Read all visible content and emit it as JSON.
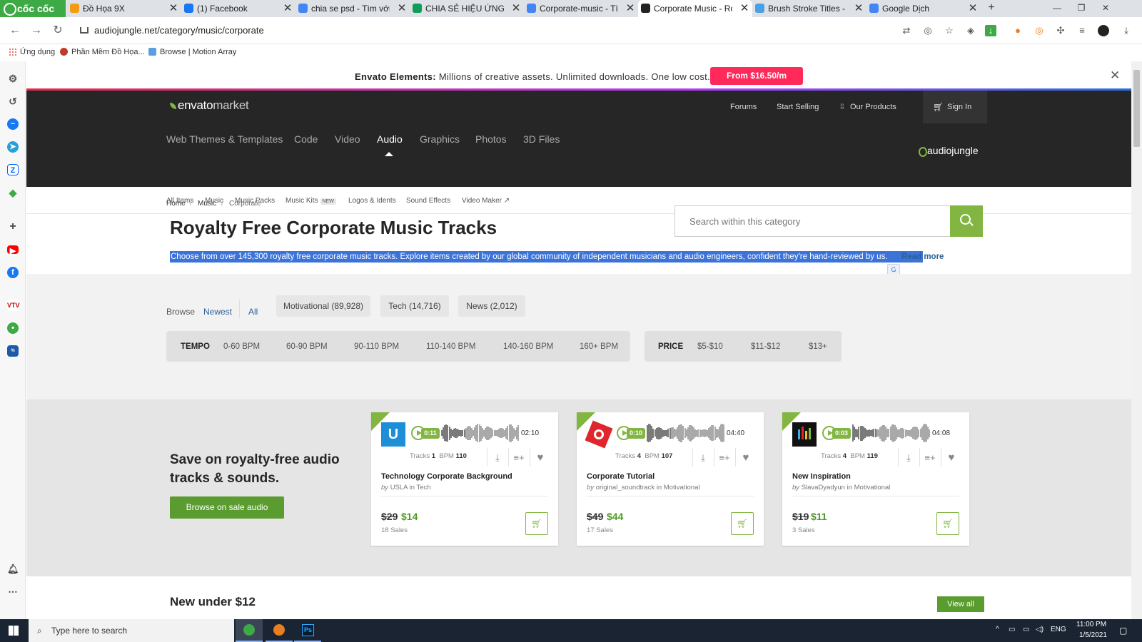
{
  "browser": {
    "brand": "cốc cốc",
    "tabs": [
      {
        "title": "Đồ Họa 9X",
        "color": "#f39c12"
      },
      {
        "title": "(1) Facebook",
        "color": "#1877f2"
      },
      {
        "title": "chia se psd - Tìm với G",
        "color": "#4285f4"
      },
      {
        "title": "CHIA SẺ HIỆU ỨNG CH",
        "color": "#0f9d58"
      },
      {
        "title": "Corporate-music - Tìm",
        "color": "#4285f4"
      },
      {
        "title": "Corporate Music - Roy",
        "color": "#222222"
      },
      {
        "title": "Brush Stroke Titles - Pr",
        "color": "#4aa0e6"
      },
      {
        "title": "Google Dịch",
        "color": "#4285f4"
      }
    ],
    "new_tab": "+",
    "url": "audiojungle.net/category/music/corporate",
    "bookmarks": [
      "Ứng dụng",
      "Phần Mềm Đồ Họa...",
      "Browse | Motion Array"
    ]
  },
  "banner": {
    "brand": "Envato Elements:",
    "text": "Millions of creative assets. Unlimited downloads. One low cost.",
    "cta": "From $16.50/m",
    "close": "✕"
  },
  "header": {
    "brand": "envato",
    "brand_suffix": "market",
    "top_links": [
      "Forums",
      "Start Selling",
      "Our Products",
      "Sign In"
    ],
    "main_nav": [
      "Web Themes & Templates",
      "Code",
      "Video",
      "Audio",
      "Graphics",
      "Photos",
      "3D Files"
    ],
    "active_nav": "Audio",
    "site_badge": "audiojungle"
  },
  "subnav": {
    "items": [
      "All Items",
      "Music",
      "Music Packs",
      "Music Kits",
      "Logos & Idents",
      "Sound Effects",
      "Video Maker"
    ],
    "new_badge": "NEW"
  },
  "breadcrumb": [
    "Home",
    "Music",
    "Corporate"
  ],
  "page_title": "Royalty Free Corporate Music Tracks",
  "search": {
    "placeholder": "Search within this category"
  },
  "description": "Choose from over 145,300 royalty free corporate music tracks. Explore items created by our global community of independent musicians and audio engineers, confident they're hand-reviewed by us.",
  "read_more": "Read more",
  "browse": {
    "label": "Browse",
    "links": [
      "Newest",
      "All"
    ],
    "chips": [
      "Motivational (89,928)",
      "Tech (14,716)",
      "News (2,012)"
    ]
  },
  "tempo": {
    "label": "TEMPO",
    "options": [
      "0-60 BPM",
      "60-90 BPM",
      "90-110 BPM",
      "110-140 BPM",
      "140-160 BPM",
      "160+ BPM"
    ]
  },
  "price": {
    "label": "PRICE",
    "options": [
      "$5-$10",
      "$11-$12",
      "$13+"
    ]
  },
  "sale": {
    "heading": "Save on royalty-free audio tracks & sounds.",
    "button": "Browse on sale audio",
    "tracks_label": "Tracks",
    "bpm_label": "BPM",
    "cards": [
      {
        "time": "0:11",
        "duration": "02:10",
        "tracks": "1",
        "bpm": "110",
        "title": "Technology Corporate Background",
        "author": "USLA",
        "category": "Tech",
        "old_price": "$29",
        "price": "$14",
        "sales": "18 Sales",
        "thumb_color": "#1e8fd6"
      },
      {
        "time": "0:10",
        "duration": "04:40",
        "tracks": "4",
        "bpm": "107",
        "title": "Corporate Tutorial",
        "author": "original_soundtrack",
        "category": "Motivational",
        "old_price": "$49",
        "price": "$44",
        "sales": "17 Sales",
        "thumb_color": "#e0262d"
      },
      {
        "time": "0:03",
        "duration": "04:08",
        "tracks": "4",
        "bpm": "119",
        "title": "New Inspiration",
        "author": "SlavaDyadyun",
        "category": "Motivational",
        "old_price": "$19",
        "price": "$11",
        "sales": "3 Sales",
        "thumb_color": "#111111"
      }
    ]
  },
  "new_under": {
    "heading": "New under $12",
    "button": "View all"
  },
  "taskbar": {
    "search_placeholder": "Type here to search",
    "lang": "ENG",
    "time": "11:00 PM",
    "date": "1/5/2021"
  }
}
